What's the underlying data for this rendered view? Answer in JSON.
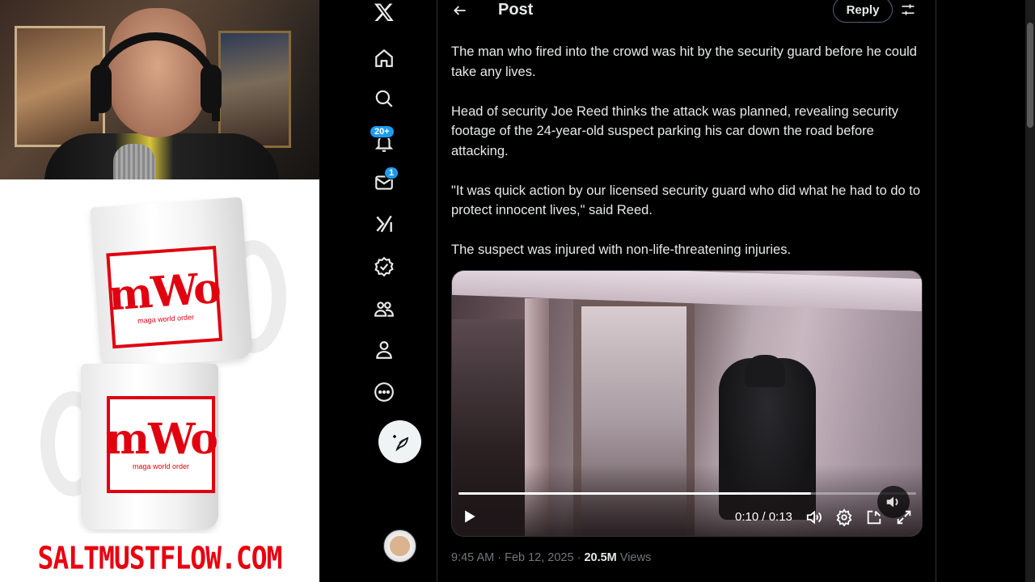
{
  "stream": {
    "site_banner": "SALTMUSTFLOW.COM",
    "merch": {
      "logo_text": "mWo",
      "logo_subtext": "maga world order"
    }
  },
  "nav": {
    "items": [
      {
        "name": "x-logo",
        "label": "X"
      },
      {
        "name": "home",
        "label": "Home"
      },
      {
        "name": "explore",
        "label": "Explore"
      },
      {
        "name": "notifications",
        "label": "Notifications",
        "badge": "20+"
      },
      {
        "name": "messages",
        "label": "Messages",
        "badge": "1"
      },
      {
        "name": "grok",
        "label": "Grok"
      },
      {
        "name": "verified",
        "label": "Verified"
      },
      {
        "name": "communities",
        "label": "Communities"
      },
      {
        "name": "profile",
        "label": "Profile"
      },
      {
        "name": "more",
        "label": "More"
      }
    ],
    "post_button_label": "Post"
  },
  "header": {
    "title": "Post",
    "reply_label": "Reply"
  },
  "tweet": {
    "paragraphs": [
      "The man who fired into the crowd was hit by the security guard before he could take any lives.",
      "Head of security Joe Reed thinks the attack was planned, revealing security footage of the 24-year-old suspect parking his car down the road before attacking.",
      "\"It was quick action by our licensed security guard who did what he had to do to protect innocent lives,\" said Reed.",
      "The suspect was injured with non-life-threatening injuries."
    ],
    "video": {
      "time_display": "0:10 / 0:13",
      "progress_fraction": 0.77
    },
    "meta": {
      "time": "9:45 AM",
      "date": "Feb 12, 2025",
      "views_count": "20.5M",
      "views_label": "Views",
      "separator": " · "
    }
  },
  "colors": {
    "accent": "#1d9bf0",
    "text_primary": "#e7e9ea",
    "text_secondary": "#71767b",
    "brand_red": "#e00010"
  }
}
